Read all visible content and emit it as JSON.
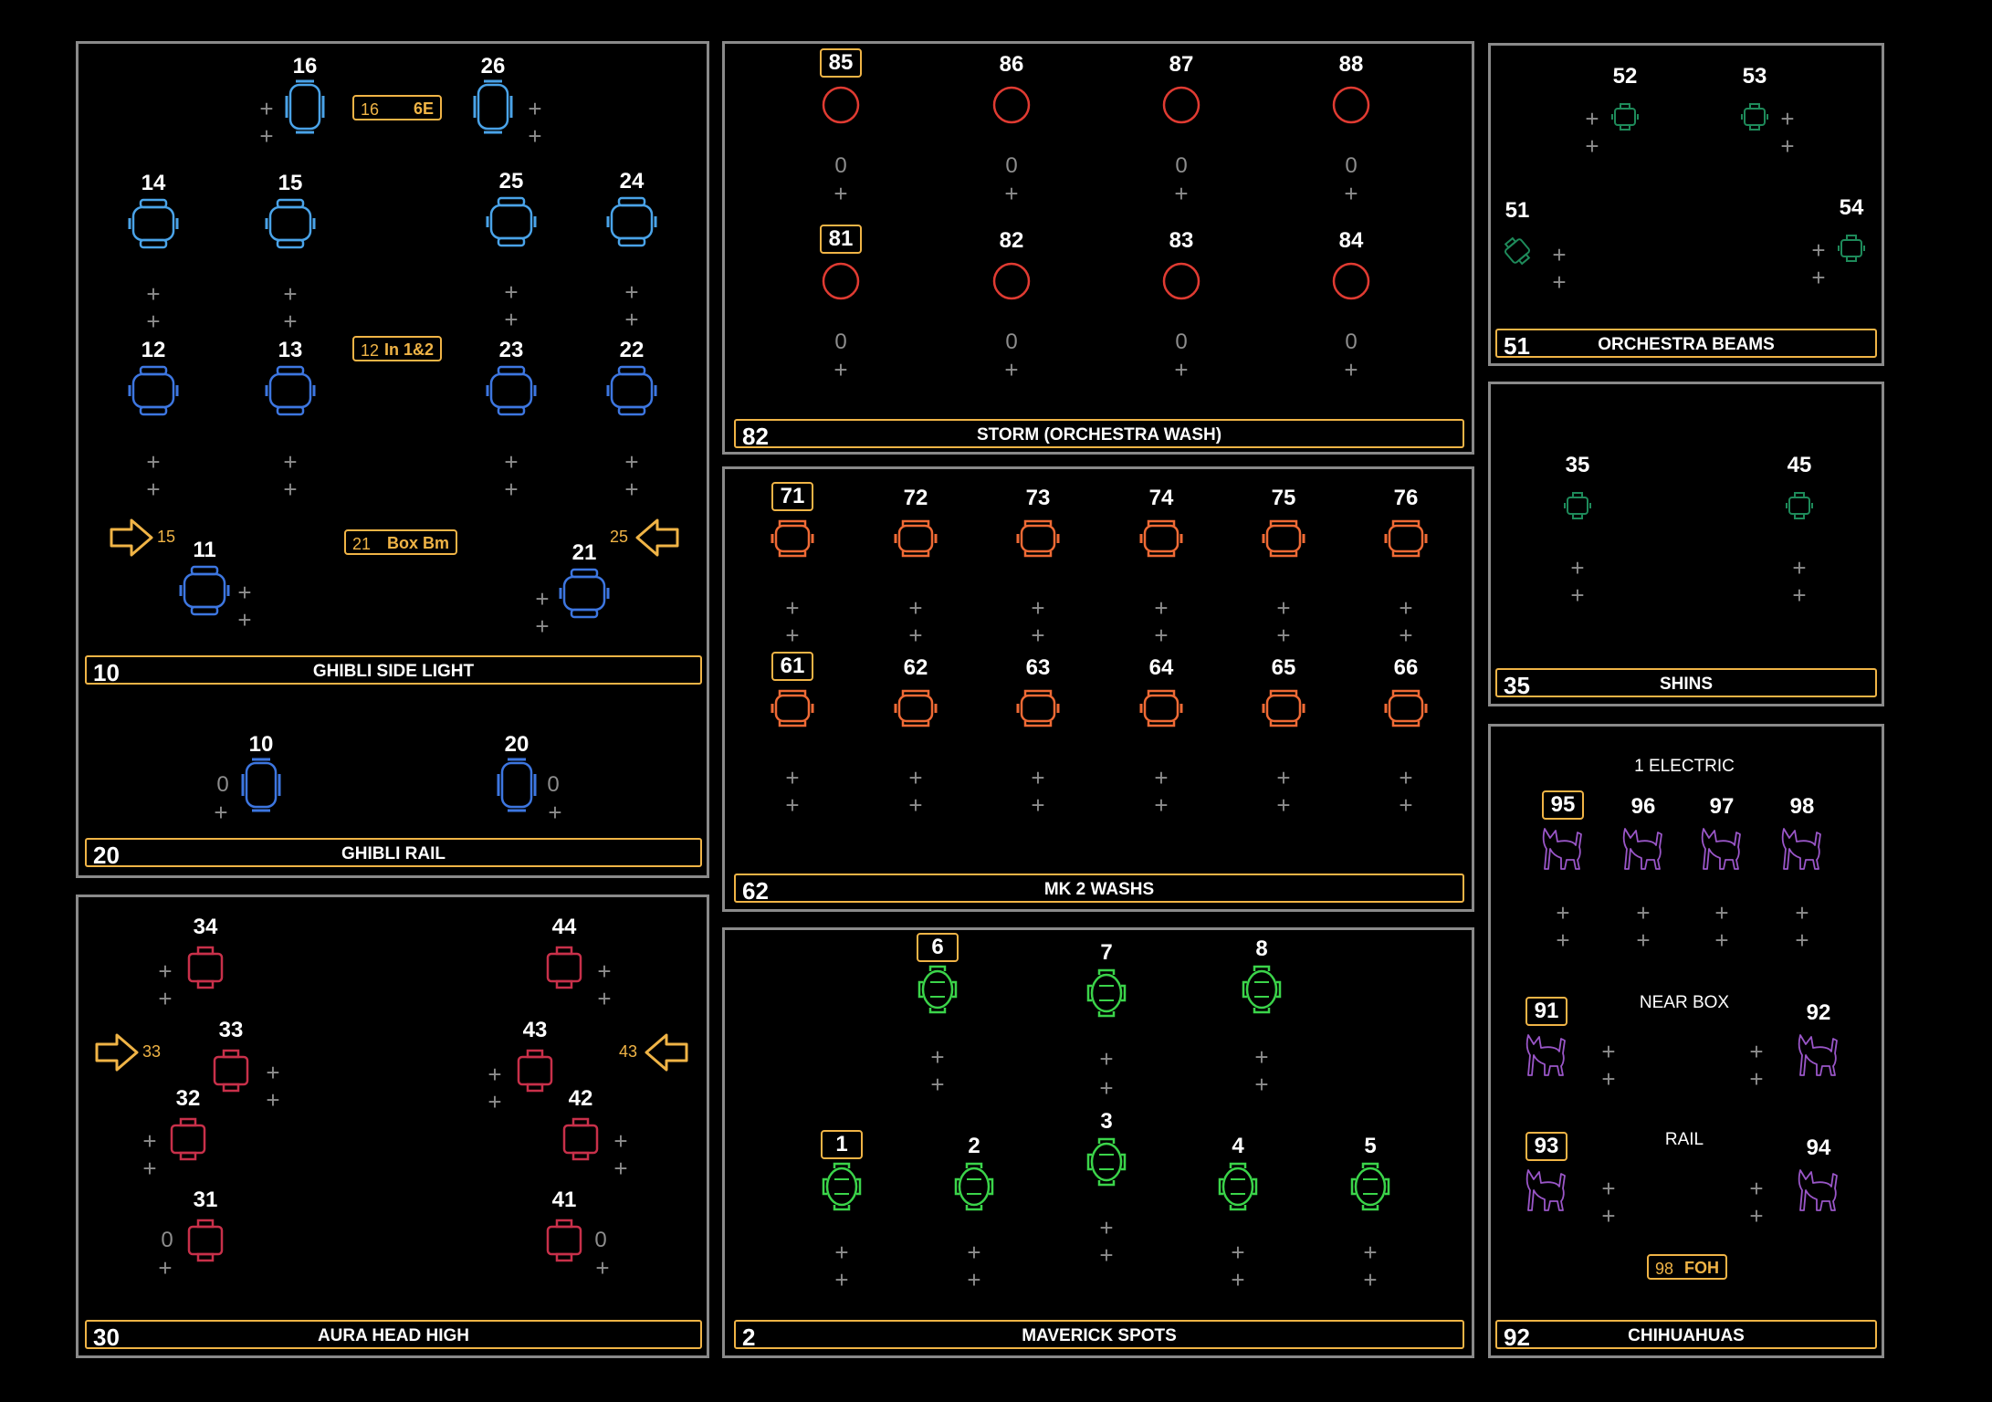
{
  "colors": {
    "border": "#8a8a8a",
    "accent": "#f0b446",
    "blue_light": "#4aa3e8",
    "blue_dark": "#3d76e0",
    "red": "#e03b32",
    "orange": "#ef6a35",
    "crimson": "#c8304a",
    "green": "#3bd44a",
    "teal": "#1e8a5a",
    "purple": "#9a56c8",
    "plus": "#8d8d8d"
  },
  "panels": {
    "ghibli_side": {
      "number": "10",
      "title": "GHIBLI SIDE LIGHT"
    },
    "ghibli_rail": {
      "number": "20",
      "title": "GHIBLI RAIL"
    },
    "aura": {
      "number": "30",
      "title": "AURA HEAD HIGH"
    },
    "storm": {
      "number": "82",
      "title": "STORM (ORCHESTRA WASH)"
    },
    "mk2": {
      "number": "62",
      "title": "MK 2 WASHS"
    },
    "maverick": {
      "number": "2",
      "title": "MAVERICK SPOTS"
    },
    "orch_beams": {
      "number": "51",
      "title": "ORCHESTRA BEAMS"
    },
    "shins": {
      "number": "35",
      "title": "SHINS"
    },
    "chihuahuas": {
      "number": "92",
      "title": "CHIHUAHUAS"
    }
  },
  "tags": {
    "t16": {
      "a": "16",
      "b": "6E"
    },
    "t12": {
      "a": "12",
      "b": "In 1&2"
    },
    "t21": {
      "a": "21",
      "b": "Box Bm"
    },
    "t98": {
      "a": "98",
      "b": "FOH"
    }
  },
  "arrows": {
    "a15": "15",
    "a25": "25",
    "a33": "33",
    "a43": "43"
  },
  "captions": {
    "electric": "1 ELECTRIC",
    "near_box": "NEAR BOX",
    "rail": "RAIL"
  },
  "fixtures": {
    "f16": "16",
    "f26": "26",
    "f14": "14",
    "f15": "15",
    "f25": "25",
    "f24": "24",
    "f12": "12",
    "f13": "13",
    "f23": "23",
    "f22": "22",
    "f11": "11",
    "f21": "21",
    "f10": "10",
    "f20": "20",
    "f34": "34",
    "f44": "44",
    "f33": "33",
    "f43": "43",
    "f32": "32",
    "f42": "42",
    "f31": "31",
    "f41": "41",
    "f85": "85",
    "f86": "86",
    "f87": "87",
    "f88": "88",
    "f81": "81",
    "f82": "82",
    "f83": "83",
    "f84": "84",
    "f71": "71",
    "f72": "72",
    "f73": "73",
    "f74": "74",
    "f75": "75",
    "f76": "76",
    "f61": "61",
    "f62": "62",
    "f63": "63",
    "f64": "64",
    "f65": "65",
    "f66": "66",
    "f6": "6",
    "f7": "7",
    "f8": "8",
    "f1": "1",
    "f2": "2",
    "f3": "3",
    "f4": "4",
    "f5": "5",
    "f52": "52",
    "f53": "53",
    "f51": "51",
    "f54": "54",
    "f35": "35",
    "f45": "45",
    "f95": "95",
    "f96": "96",
    "f97": "97",
    "f98": "98",
    "f91": "91",
    "f92": "92",
    "f93": "93",
    "f94": "94"
  },
  "plus_symbol": "+",
  "zero_value": "0"
}
